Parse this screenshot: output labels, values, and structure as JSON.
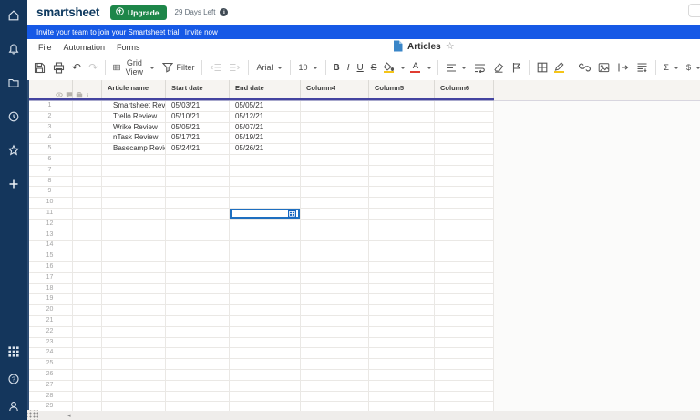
{
  "topbar": {
    "logo": "smartsheet",
    "upgrade_label": "Upgrade",
    "trial_status": "29 Days Left"
  },
  "banner": {
    "message": "Invite your team to join your Smartsheet trial.",
    "link_label": "Invite now"
  },
  "menubar": {
    "items": [
      "File",
      "Automation",
      "Forms"
    ]
  },
  "title": {
    "sheet_name": "Articles"
  },
  "toolbar": {
    "view_selector": "Grid View",
    "filter": "Filter",
    "font_family": "Arial",
    "font_size": "10",
    "bold": "B",
    "italic": "I",
    "underline": "U",
    "strikethrough": "S",
    "text_color": "A",
    "sum": "Σ",
    "currency": "$",
    "percent": "%"
  },
  "sidebar": {
    "icons": [
      "home",
      "notifications",
      "browse",
      "recents",
      "favorites",
      "create",
      "app-launcher",
      "help",
      "account"
    ]
  },
  "grid": {
    "columns": [
      "Article name",
      "Start date",
      "End date",
      "Column4",
      "Column5",
      "Column6"
    ],
    "row_header_icons": [
      "eye-icon",
      "comment-icon",
      "attachment-icon",
      "info-icon"
    ],
    "rows": [
      {
        "row": 1,
        "article_name": "Smartsheet Review",
        "start_date": "05/03/21",
        "end_date": "05/05/21"
      },
      {
        "row": 2,
        "article_name": "Trello Review",
        "start_date": "05/10/21",
        "end_date": "05/12/21"
      },
      {
        "row": 3,
        "article_name": "Wrike Review",
        "start_date": "05/05/21",
        "end_date": "05/07/21"
      },
      {
        "row": 4,
        "article_name": "nTask Review",
        "start_date": "05/17/21",
        "end_date": "05/19/21"
      },
      {
        "row": 5,
        "article_name": "Basecamp Review",
        "start_date": "05/24/21",
        "end_date": "05/26/21"
      }
    ],
    "total_rows": 29,
    "selected": {
      "row": 11,
      "column": "End date"
    }
  },
  "colors": {
    "sidebar_navy": "#14365c",
    "banner_blue": "#1659e6",
    "upgrade_green": "#1d8649",
    "selection_blue": "#1e6fc0",
    "header_divider": "#4444a0",
    "fill_accent_yellow": "#f5c518",
    "text_accent_red": "#e03c31",
    "calendar_icon_blue": "#1565c0"
  }
}
